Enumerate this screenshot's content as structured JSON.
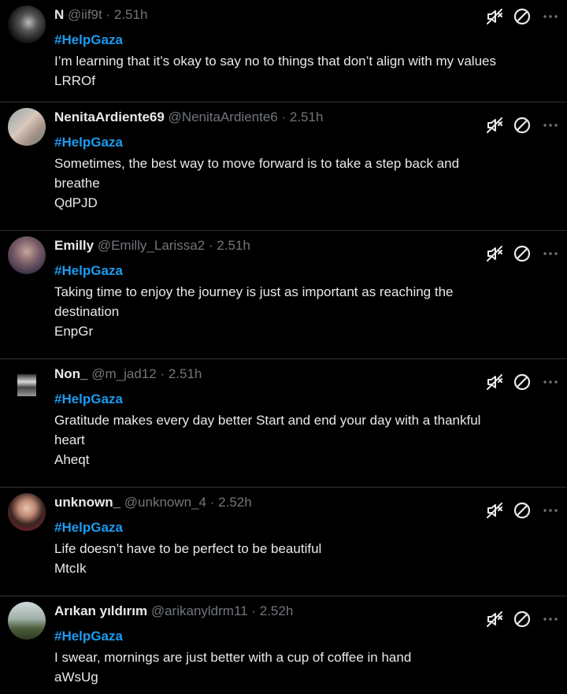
{
  "posts": [
    {
      "name": "N",
      "handle": "@iif9t",
      "separator": "·",
      "time": "2.51h",
      "hashtag": "#HelpGaza",
      "lines": [
        "I’m learning that it’s okay to say no to things that don’t align with my values",
        "LRROf"
      ],
      "avatar": "dark-avatar"
    },
    {
      "name": "NenitaArdiente69",
      "handle": "@NenitaArdiente6",
      "separator": "·",
      "time": "2.51h",
      "hashtag": "#HelpGaza",
      "lines": [
        "Sometimes, the best way to move forward is to take a step back and",
        "breathe",
        "QdPJD"
      ],
      "avatar": "photo-avatar"
    },
    {
      "name": "Emilly",
      "handle": "@Emilly_Larissa2",
      "separator": "·",
      "time": "2.51h",
      "hashtag": "#HelpGaza",
      "lines": [
        "Taking time to enjoy the journey is just as important as reaching the",
        "destination",
        "EnpGr"
      ],
      "avatar": "photo-avatar"
    },
    {
      "name": "Non_",
      "handle": "@m_jad12",
      "separator": "·",
      "time": "2.51h",
      "hashtag": "#HelpGaza",
      "lines": [
        "Gratitude makes every day better Start and end your day with a thankful",
        "heart",
        "Aheqt"
      ],
      "avatar": "photo-avatar"
    },
    {
      "name": "unknown_",
      "handle": "@unknown_4",
      "separator": "·",
      "time": "2.52h",
      "hashtag": "#HelpGaza",
      "lines": [
        "Life doesn’t have to be perfect to be beautiful",
        "MtcIk"
      ],
      "avatar": "photo-avatar"
    },
    {
      "name": "Arıkan yıldırım",
      "handle": "@arikanyldrm11",
      "separator": "·",
      "time": "2.52h",
      "hashtag": "#HelpGaza",
      "lines": [
        "I swear, mornings are just better with a cup of coffee in hand",
        "aWsUg"
      ],
      "avatar": "photo-avatar"
    }
  ],
  "icons": {
    "mute": "mute-icon",
    "block": "block-icon",
    "more": "more-icon"
  },
  "colors": {
    "background": "#000000",
    "text": "#e7e9ea",
    "muted": "#71767b",
    "accent": "#1d9bf0",
    "divider": "#2f3336"
  }
}
